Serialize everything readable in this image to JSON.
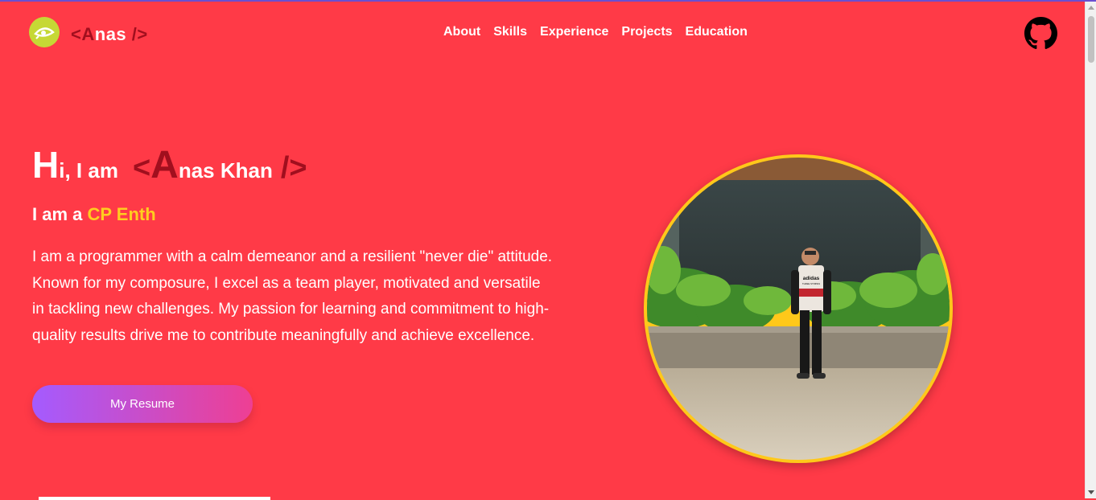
{
  "brand": {
    "logo_open": "<",
    "logo_initial": "A",
    "logo_rest": "nas",
    "logo_close": " />",
    "badge_icon": "eye-logo-icon"
  },
  "nav": {
    "items": [
      "About",
      "Skills",
      "Experience",
      "Projects",
      "Education"
    ]
  },
  "header": {
    "github_icon": "github-icon"
  },
  "hero": {
    "hi_initial": "H",
    "hi_rest": "i, I am",
    "name_open": "<",
    "name_initial": "A",
    "name_rest": "nas Khan",
    "name_close": "/>",
    "role_prefix": "I am a",
    "role_typed": "CP Enth",
    "description": "I am a programmer with a calm demeanor and a resilient \"never die\" attitude. Known for my composure, I excel as a team player, motivated and versatile in tackling new challenges. My passion for learning and commitment to high-quality results drive me to contribute meaningfully and achieve excellence.",
    "resume_label": "My Resume"
  },
  "photo": {
    "shirt_brand": "adidas",
    "shirt_subtext": "THREE STRIPES"
  },
  "colors": {
    "background": "#ff3a47",
    "accent_dark": "#a10f1e",
    "highlight": "#ffcd1f",
    "ring": "#ffc81a",
    "button_from": "#a45bff",
    "button_to": "#ee3f93"
  }
}
